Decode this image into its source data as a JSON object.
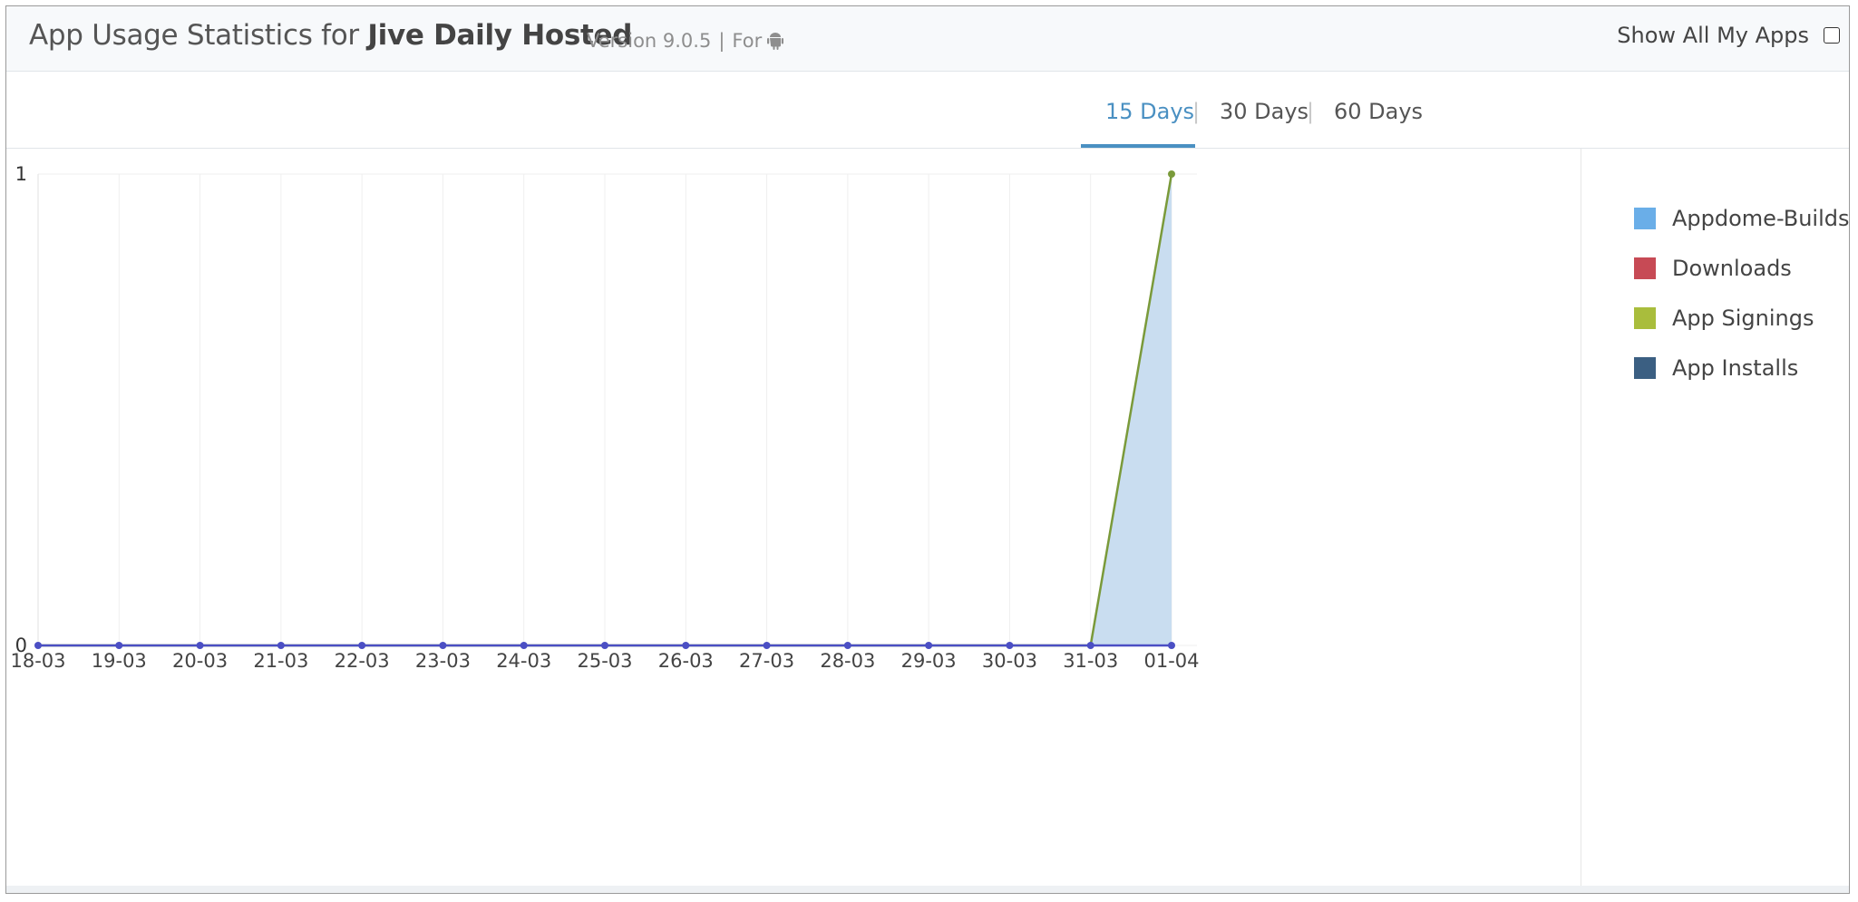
{
  "header": {
    "title_prefix": "App Usage Statistics for ",
    "app_name": "Jive Daily Hosted",
    "version": "Version 9.0.5",
    "separator": "|",
    "for_label": "For",
    "platform_icon": "android-icon",
    "show_all_label": "Show All My Apps",
    "show_all_checked": false
  },
  "tabs": [
    {
      "label": "15 Days",
      "active": true
    },
    {
      "label": "30 Days",
      "active": false
    },
    {
      "label": "60 Days",
      "active": false
    }
  ],
  "tab_separator": "|",
  "legend": [
    {
      "label": "Appdome-Builds",
      "color": "#6aaee8"
    },
    {
      "label": "Downloads",
      "color": "#c74a55"
    },
    {
      "label": "App Signings",
      "color": "#a9bd3c"
    },
    {
      "label": "App Installs",
      "color": "#3b5f82"
    }
  ],
  "colors": {
    "accent": "#4a90c2",
    "area_fill": "#c9ddf0",
    "signings_line": "#7a9a3a",
    "zero_line": "#4b4fc4"
  },
  "chart_data": {
    "type": "area",
    "categories": [
      "18-03",
      "19-03",
      "20-03",
      "21-03",
      "22-03",
      "23-03",
      "24-03",
      "25-03",
      "26-03",
      "27-03",
      "28-03",
      "29-03",
      "30-03",
      "31-03",
      "01-04"
    ],
    "ylim": [
      0,
      1
    ],
    "yticks": [
      "0",
      "1"
    ],
    "series": [
      {
        "name": "Appdome-Builds",
        "values": [
          0,
          0,
          0,
          0,
          0,
          0,
          0,
          0,
          0,
          0,
          0,
          0,
          0,
          0,
          1
        ]
      },
      {
        "name": "Downloads",
        "values": [
          0,
          0,
          0,
          0,
          0,
          0,
          0,
          0,
          0,
          0,
          0,
          0,
          0,
          0,
          0
        ]
      },
      {
        "name": "App Signings",
        "values": [
          0,
          0,
          0,
          0,
          0,
          0,
          0,
          0,
          0,
          0,
          0,
          0,
          0,
          0,
          1
        ]
      },
      {
        "name": "App Installs",
        "values": [
          0,
          0,
          0,
          0,
          0,
          0,
          0,
          0,
          0,
          0,
          0,
          0,
          0,
          0,
          0
        ]
      }
    ],
    "grid": true,
    "legend_position": "right"
  }
}
